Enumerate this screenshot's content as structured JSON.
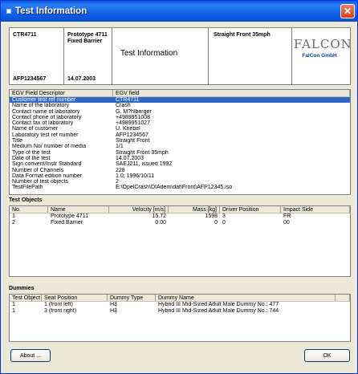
{
  "window": {
    "title": "Test Information",
    "close_glyph": "✕"
  },
  "header": {
    "id": "CTR4711",
    "ref": "AFP1234567",
    "prototype_line1": "Prototype 4711",
    "prototype_line2": "Fixed Barrier",
    "date": "14.07.2003",
    "title": "Test Information",
    "test_type": "Straight Front 35mph",
    "logo_main": "FALCON",
    "logo_sub": "FalCon GmbH"
  },
  "fields": {
    "col1": "EGV Field Descriptor",
    "col2": "EGV field",
    "rows": [
      [
        "Customer test ref number",
        "CTR4711"
      ],
      [
        "Name of the laboratory",
        "Crash"
      ],
      [
        "Contact name of laboratory",
        "G. M?hlberger"
      ],
      [
        "Contact phone of laboratory",
        "+4989951008"
      ],
      [
        "Contact fax of laboratory",
        "+4989951027"
      ],
      [
        "Name of customer",
        "U. Knebel"
      ],
      [
        "Laboratory test ref number",
        "AFP1234567"
      ],
      [
        "Title",
        "Straight Front"
      ],
      [
        "Medium No/ number of media",
        "1/1"
      ],
      [
        "Type of the test",
        "Straight Front 35mph"
      ],
      [
        "Date of the test",
        "14.07.2003"
      ],
      [
        "Sign convent/Instr Standard",
        "SAEJ211, issued 1992"
      ],
      [
        "Number of Channels",
        "228"
      ],
      [
        "Data Format edition number",
        "1.0; 1996/10/11"
      ],
      [
        "Number of test objects",
        "2"
      ],
      [
        "TestFilePath",
        "E:\\OpelCrash\\DIAdem\\dat\\Front\\AFP12345.iso"
      ]
    ]
  },
  "test_objects": {
    "section_title": "Test Objects",
    "headers": [
      "No.",
      "Name",
      "Velocity [m/s]",
      "Mass [kg]",
      "Driver Position",
      "Impact Side"
    ],
    "rows": [
      [
        "1",
        "Prototype 4711",
        "15.72",
        "1598",
        "3",
        "FR"
      ],
      [
        "2",
        "Fixed Barrier",
        "0.00",
        "0",
        "0",
        "00"
      ]
    ]
  },
  "dummies": {
    "section_title": "Dummies",
    "headers": [
      "Test Object",
      "Seat Position",
      "Dummy Type",
      "Dummy Name"
    ],
    "rows": [
      [
        "1",
        "1  (front left)",
        "H3",
        "Hybrid III Mid-Sized Adult Male Dummy No.: 477"
      ],
      [
        "1",
        "3  (front right)",
        "H3",
        "Hybrid III Mid-Sized Adult Male Dummy No.: 744"
      ]
    ]
  },
  "buttons": {
    "about": "About ...",
    "ok": "OK"
  }
}
